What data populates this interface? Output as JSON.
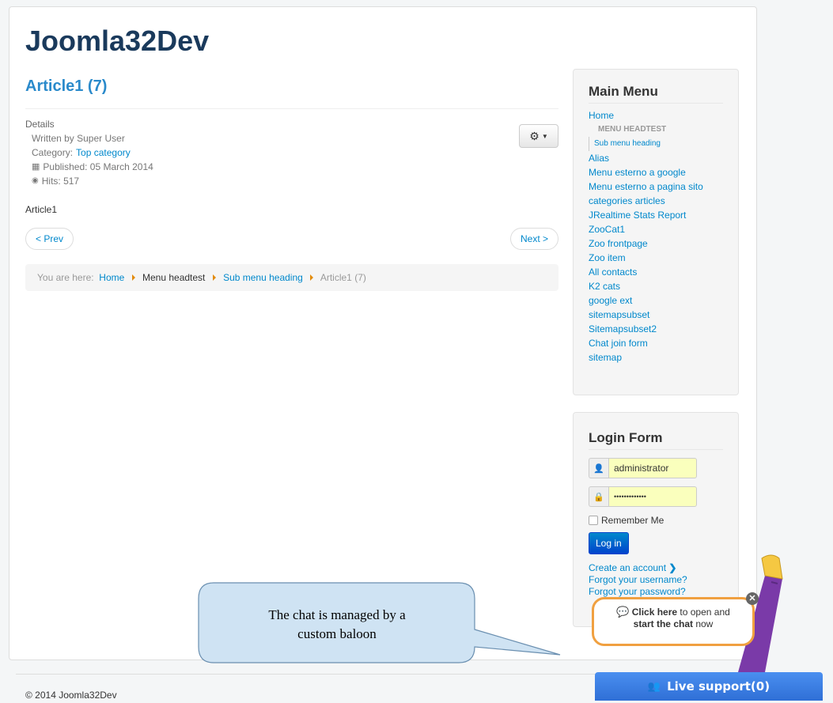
{
  "site": {
    "title": "Joomla32Dev"
  },
  "article": {
    "title": "Article1 (7)",
    "details_label": "Details",
    "written_by": "Written by Super User",
    "category_label": "Category:",
    "category_value": "Top category",
    "published": "Published: 05 March 2014",
    "hits": "Hits: 517",
    "body": "Article1"
  },
  "pager": {
    "prev": "< Prev",
    "next": "Next >"
  },
  "breadcrumb": {
    "prefix": "You are here:",
    "items": [
      "Home",
      "Menu headtest",
      "Sub menu heading",
      "Article1 (7)"
    ]
  },
  "main_menu": {
    "title": "Main Menu",
    "items": [
      "Home",
      "MENU HEADTEST",
      "Sub menu heading",
      "Alias",
      "Menu esterno a google",
      "Menu esterno a pagina sito",
      "categories articles",
      "JRealtime Stats Report",
      "ZooCat1",
      "Zoo frontpage",
      "Zoo item",
      "All contacts",
      "K2 cats",
      "google ext",
      "sitemapsubset",
      "Sitemapsubset2",
      "Chat join form",
      "sitemap"
    ]
  },
  "login": {
    "title": "Login Form",
    "username": "administrator",
    "password": "•••••••••••••",
    "remember": "Remember Me",
    "button": "Log in",
    "create_account": "Create an account",
    "forgot_username": "Forgot your username?",
    "forgot_password": "Forgot your password?"
  },
  "callout": {
    "text_line1": "The chat is managed by a",
    "text_line2": "custom baloon"
  },
  "chat": {
    "bold1": "Click here",
    "rest1": " to open and",
    "bold2": "start the chat",
    "rest2": " now",
    "live_support": "Live support(0)"
  },
  "footer": {
    "copyright": "© 2014 Joomla32Dev"
  }
}
